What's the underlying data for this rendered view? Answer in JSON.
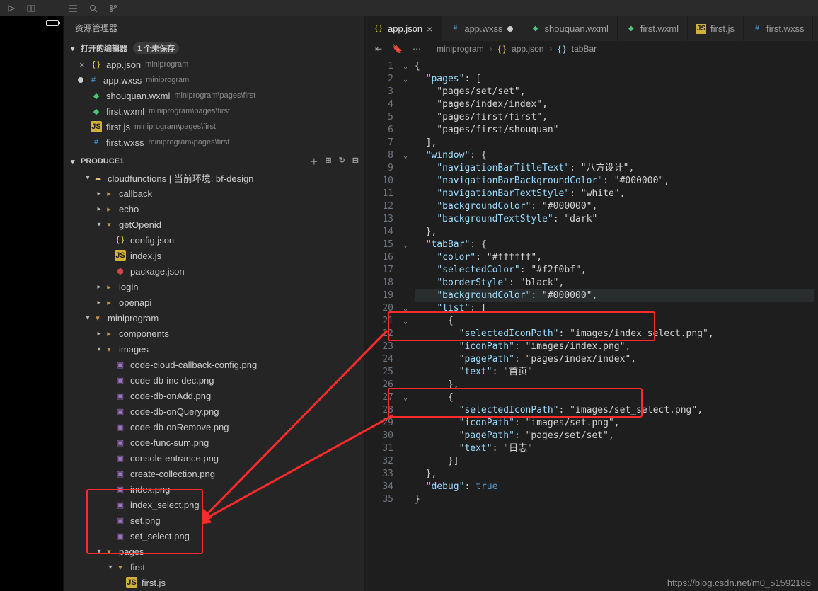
{
  "topbar": {
    "actions": [
      "play-icon",
      "window-icon",
      "list-icon",
      "search-icon",
      "branch-icon"
    ],
    "right_action": "fold-icon"
  },
  "sidebar": {
    "title": "资源管理器",
    "open_editors": {
      "label": "打开的编辑器",
      "badge": "1 个未保存"
    },
    "open_files": [
      {
        "prefix": "x",
        "icon": "json",
        "name": "app.json",
        "sub": "miniprogram"
      },
      {
        "prefix": "dot",
        "icon": "wxss",
        "name": "app.wxss",
        "sub": "miniprogram"
      },
      {
        "prefix": "",
        "icon": "wxml",
        "name": "shouquan.wxml",
        "sub": "miniprogram\\pages\\first"
      },
      {
        "prefix": "",
        "icon": "wxml",
        "name": "first.wxml",
        "sub": "miniprogram\\pages\\first"
      },
      {
        "prefix": "",
        "icon": "js",
        "name": "first.js",
        "sub": "miniprogram\\pages\\first"
      },
      {
        "prefix": "",
        "icon": "wxss",
        "name": "first.wxss",
        "sub": "miniprogram\\pages\\first"
      }
    ],
    "project": {
      "label": "PRODUCE1",
      "actions": [
        "plus-icon",
        "new-folder-icon",
        "refresh-icon",
        "collapse-icon"
      ]
    },
    "tree": [
      {
        "depth": 1,
        "chev": "v",
        "icon": "cloud",
        "label": "cloudfunctions | 当前环境: bf-design"
      },
      {
        "depth": 2,
        "chev": ">",
        "icon": "folder",
        "label": "callback"
      },
      {
        "depth": 2,
        "chev": ">",
        "icon": "folder",
        "label": "echo"
      },
      {
        "depth": 2,
        "chev": "v",
        "icon": "folder-open",
        "label": "getOpenid"
      },
      {
        "depth": 3,
        "chev": "",
        "icon": "json",
        "label": "config.json"
      },
      {
        "depth": 3,
        "chev": "",
        "icon": "js",
        "label": "index.js"
      },
      {
        "depth": 3,
        "chev": "",
        "icon": "npm",
        "label": "package.json"
      },
      {
        "depth": 2,
        "chev": ">",
        "icon": "folder",
        "label": "login"
      },
      {
        "depth": 2,
        "chev": ">",
        "icon": "folder",
        "label": "openapi"
      },
      {
        "depth": 1,
        "chev": "v",
        "icon": "folder-open",
        "label": "miniprogram"
      },
      {
        "depth": 2,
        "chev": ">",
        "icon": "folder",
        "label": "components"
      },
      {
        "depth": 2,
        "chev": "v",
        "icon": "folder-open",
        "label": "images"
      },
      {
        "depth": 3,
        "chev": "",
        "icon": "img",
        "label": "code-cloud-callback-config.png"
      },
      {
        "depth": 3,
        "chev": "",
        "icon": "img",
        "label": "code-db-inc-dec.png"
      },
      {
        "depth": 3,
        "chev": "",
        "icon": "img",
        "label": "code-db-onAdd.png"
      },
      {
        "depth": 3,
        "chev": "",
        "icon": "img",
        "label": "code-db-onQuery.png"
      },
      {
        "depth": 3,
        "chev": "",
        "icon": "img",
        "label": "code-db-onRemove.png"
      },
      {
        "depth": 3,
        "chev": "",
        "icon": "img",
        "label": "code-func-sum.png"
      },
      {
        "depth": 3,
        "chev": "",
        "icon": "img",
        "label": "console-entrance.png"
      },
      {
        "depth": 3,
        "chev": "",
        "icon": "img",
        "label": "create-collection.png"
      },
      {
        "depth": 3,
        "chev": "",
        "icon": "img",
        "label": "index.png"
      },
      {
        "depth": 3,
        "chev": "",
        "icon": "img",
        "label": "index_select.png"
      },
      {
        "depth": 3,
        "chev": "",
        "icon": "img",
        "label": "set.png"
      },
      {
        "depth": 3,
        "chev": "",
        "icon": "img",
        "label": "set_select.png"
      },
      {
        "depth": 2,
        "chev": "v",
        "icon": "folder-open",
        "label": "pages"
      },
      {
        "depth": 3,
        "chev": "v",
        "icon": "folder-open",
        "label": "first"
      },
      {
        "depth": 4,
        "chev": "",
        "icon": "js",
        "label": "first.js"
      }
    ]
  },
  "tabs": [
    {
      "icon": "json",
      "label": "app.json",
      "state": "active"
    },
    {
      "icon": "wxss",
      "label": "app.wxss",
      "state": "modified"
    },
    {
      "icon": "wxml",
      "label": "shouquan.wxml",
      "state": ""
    },
    {
      "icon": "wxml",
      "label": "first.wxml",
      "state": ""
    },
    {
      "icon": "js",
      "label": "first.js",
      "state": ""
    },
    {
      "icon": "wxss",
      "label": "first.wxss",
      "state": ""
    }
  ],
  "breadcrumbs": [
    {
      "text": "miniprogram"
    },
    {
      "text": "app.json"
    },
    {
      "text": "tabBar"
    }
  ],
  "code_lines": [
    "{",
    "  \"pages\": [",
    "    \"pages/set/set\",",
    "    \"pages/index/index\",",
    "    \"pages/first/first\",",
    "    \"pages/first/shouquan\"",
    "  ],",
    "  \"window\": {",
    "    \"navigationBarTitleText\": \"八方设计\",",
    "    \"navigationBarBackgroundColor\": \"#000000\",",
    "    \"navigationBarTextStyle\": \"white\",",
    "    \"backgroundColor\": \"#000000\",",
    "    \"backgroundTextStyle\": \"dark\"",
    "  },",
    "  \"tabBar\": {",
    "    \"color\": \"#ffffff\",",
    "    \"selectedColor\": \"#f2f0bf\",",
    "    \"borderStyle\": \"black\",",
    "    \"backgroundColor\": \"#000000\",",
    "    \"list\": [",
    "      {",
    "        \"selectedIconPath\": \"images/index_select.png\",",
    "        \"iconPath\": \"images/index.png\",",
    "        \"pagePath\": \"pages/index/index\",",
    "        \"text\": \"首页\"",
    "      },",
    "      {",
    "        \"selectedIconPath\": \"images/set_select.png\",",
    "        \"iconPath\": \"images/set.png\",",
    "        \"pagePath\": \"pages/set/set\",",
    "        \"text\": \"日志\"",
    "      }]",
    "  },",
    "  \"debug\": true",
    "}"
  ],
  "fold_markers": {
    "1": "v",
    "2": "v",
    "8": "v",
    "15": "v",
    "20": "v",
    "21": "v",
    "27": "v"
  },
  "highlight_line": 19,
  "line_count": 35,
  "watermark": "https://blog.csdn.net/m0_51592186",
  "icons": {
    "json": "{ }",
    "wxss": "#",
    "wxml": "◆",
    "js": "JS",
    "folder": "▸",
    "folder-open": "▾",
    "img": "▣",
    "npm": "⬢",
    "cloud": "☁"
  }
}
